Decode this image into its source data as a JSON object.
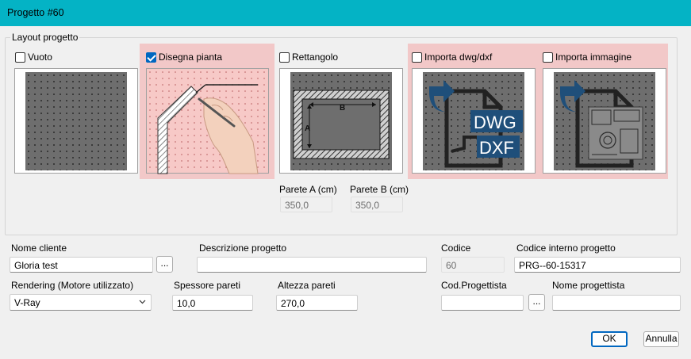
{
  "window": {
    "title": "Progetto #60"
  },
  "layout_group": {
    "label": "Layout progetto",
    "options": [
      {
        "label": "Vuoto",
        "checked": false
      },
      {
        "label": "Disegna pianta",
        "checked": true
      },
      {
        "label": "Rettangolo",
        "checked": false
      },
      {
        "label": "Importa dwg/dxf",
        "checked": false
      },
      {
        "label": "Importa immagine",
        "checked": false
      }
    ],
    "rect_labels": {
      "a": "A",
      "b": "B"
    },
    "dwg_labels": {
      "dwg": "DWG",
      "dxf": "DXF"
    },
    "wall_a": {
      "label": "Parete A (cm)",
      "value": "350,0"
    },
    "wall_b": {
      "label": "Parete B (cm)",
      "value": "350,0"
    }
  },
  "form": {
    "client_name": {
      "label": "Nome cliente",
      "value": "Gloria test",
      "browse": "..."
    },
    "description": {
      "label": "Descrizione progetto",
      "value": ""
    },
    "code": {
      "label": "Codice",
      "value": "60"
    },
    "internal_code": {
      "label": "Codice interno progetto",
      "value": "PRG--60-15317"
    },
    "rendering": {
      "label": "Rendering (Motore utilizzato)",
      "value": "V-Ray"
    },
    "wall_thickness": {
      "label": "Spessore pareti",
      "value": "10,0"
    },
    "wall_height": {
      "label": "Altezza pareti",
      "value": "270,0"
    },
    "designer_code": {
      "label": "Cod.Progettista",
      "value": "",
      "browse": "..."
    },
    "designer_name": {
      "label": "Nome progettista",
      "value": ""
    }
  },
  "buttons": {
    "ok": "OK",
    "cancel": "Annulla"
  },
  "colors": {
    "titlebar": "#04b3c5",
    "highlight": "#f2c8c8",
    "accent": "#0067c0",
    "dwg_blue": "#1f4f7a"
  }
}
